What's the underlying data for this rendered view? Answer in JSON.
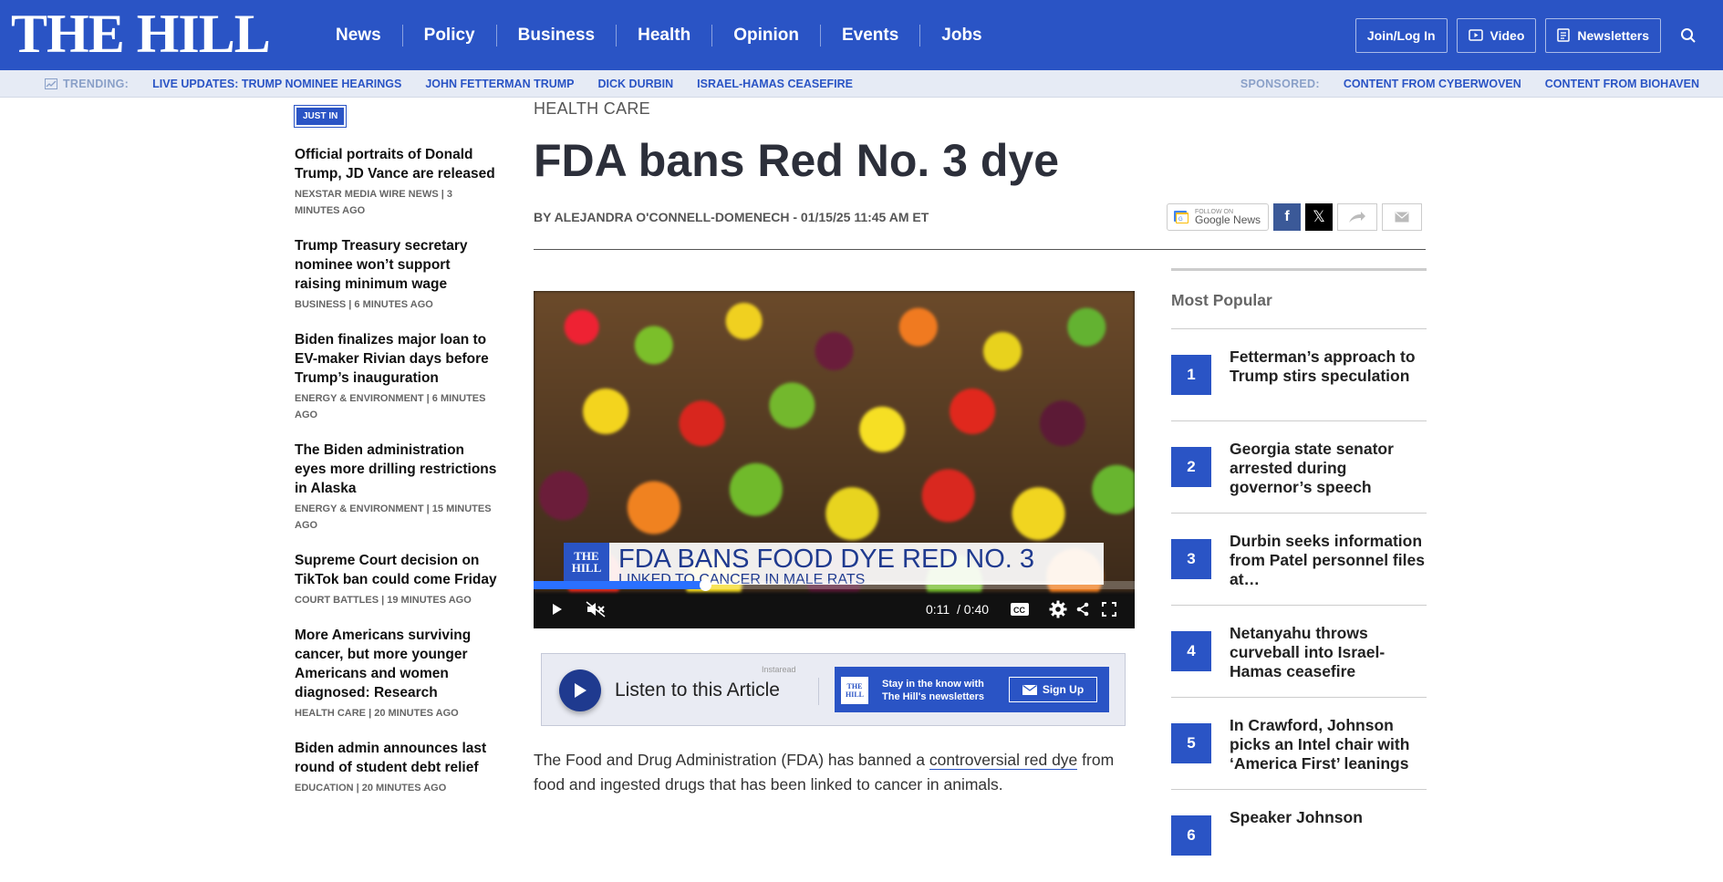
{
  "header": {
    "logo": "THE HILL",
    "nav": [
      "News",
      "Policy",
      "Business",
      "Health",
      "Opinion",
      "Events",
      "Jobs"
    ],
    "buttons": {
      "login": "Join/Log In",
      "video": "Video",
      "newsletters": "Newsletters"
    }
  },
  "trending": {
    "label": "TRENDING:",
    "items": [
      "LIVE UPDATES: TRUMP NOMINEE HEARINGS",
      "JOHN FETTERMAN TRUMP",
      "DICK DURBIN",
      "ISRAEL-HAMAS CEASEFIRE"
    ],
    "sponsored_label": "SPONSORED:",
    "sponsored_items": [
      "CONTENT FROM CYBERWOVEN",
      "CONTENT FROM BIOHAVEN"
    ]
  },
  "just_in": {
    "badge": "JUST IN",
    "stories": [
      {
        "title": "Official portraits of Donald Trump, JD Vance are released",
        "meta": "NEXSTAR MEDIA WIRE NEWS | 3 MINUTES AGO"
      },
      {
        "title": "Trump Treasury secretary nominee won’t support raising minimum wage",
        "meta": "BUSINESS | 6 MINUTES AGO"
      },
      {
        "title": "Biden finalizes major loan to EV-maker Rivian days before Trump’s inauguration",
        "meta": "ENERGY & ENVIRONMENT | 6 MINUTES AGO"
      },
      {
        "title": "The Biden administration eyes more drilling restrictions in Alaska",
        "meta": "ENERGY & ENVIRONMENT | 15 MINUTES AGO"
      },
      {
        "title": "Supreme Court decision on TikTok ban could come Friday",
        "meta": "COURT BATTLES | 19 MINUTES AGO"
      },
      {
        "title": "More Americans surviving cancer, but more younger Americans and women diagnosed: Research",
        "meta": "HEALTH CARE | 20 MINUTES AGO"
      },
      {
        "title": "Biden admin announces last round of student debt relief",
        "meta": "EDUCATION | 20 MINUTES AGO"
      }
    ]
  },
  "article": {
    "kicker": "HEALTH CARE",
    "headline": "FDA bans Red No. 3 dye",
    "byline": "BY ALEJANDRA O'CONNELL-DOMENECH - 01/15/25 11:45 AM ET",
    "google_news": {
      "small": "FOLLOW ON",
      "label": "Google News"
    },
    "body_before_link": "The Food and Drug Administration (FDA) has banned a ",
    "body_link": "controversial red dye",
    "body_after_link": " from food and ingested drugs that has been linked to cancer in animals."
  },
  "video": {
    "logo": "THE HILL",
    "headline": "FDA BANS FOOD DYE RED NO. 3",
    "subline": "LINKED TO CANCER IN MALE RATS",
    "current_time": "0:11",
    "duration": "/ 0:40",
    "progress": 0.285
  },
  "audio_widget": {
    "listen_label": "Listen to this Article",
    "brand": "Instaread",
    "newsletter_logo": "THE HILL",
    "newsletter_text": "Stay in the know with The Hill's newsletters",
    "signup": "Sign Up"
  },
  "most_popular": {
    "title": "Most Popular",
    "items": [
      {
        "num": "1",
        "title": "Fetterman’s approach to Trump stirs speculation"
      },
      {
        "num": "2",
        "title": "Georgia state senator arrested during governor’s speech"
      },
      {
        "num": "3",
        "title": "Durbin seeks information from Patel personnel files at…"
      },
      {
        "num": "4",
        "title": "Netanyahu throws curveball into Israel-Hamas ceasefire"
      },
      {
        "num": "5",
        "title": "In Crawford, Johnson picks an Intel chair with ‘America First’ leanings"
      },
      {
        "num": "6",
        "title": "Speaker Johnson"
      }
    ]
  },
  "colors": {
    "brand": "#2a54c5",
    "trend_bg": "#e6ebf5"
  }
}
